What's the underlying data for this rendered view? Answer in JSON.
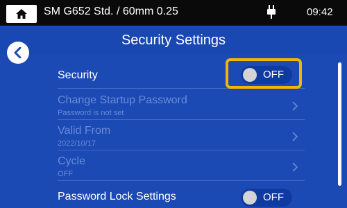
{
  "status_bar": {
    "title": "SM G652 Std. / 60mm 0.25",
    "time": "09:42"
  },
  "header": {
    "title": "Security Settings"
  },
  "settings": {
    "security": {
      "label": "Security",
      "toggle": "OFF",
      "enabled": false
    },
    "change_password": {
      "label": "Change Startup Password",
      "sub": "Password is not set"
    },
    "valid_from": {
      "label": "Valid From",
      "sub": "2022/10/17"
    },
    "cycle": {
      "label": "Cycle",
      "sub": "OFF"
    },
    "password_lock": {
      "label": "Password Lock Settings",
      "toggle": "OFF",
      "enabled": false
    }
  },
  "icons": {
    "home": "home-icon",
    "usb": "usb-icon",
    "back": "chevron-left-icon",
    "row_arrow": "chevron-right-icon"
  },
  "colors": {
    "background": "#1b4ab4",
    "status_bar": "#0a0a0a",
    "highlight": "#f4b400",
    "disabled_text": "#6a8bd6"
  }
}
